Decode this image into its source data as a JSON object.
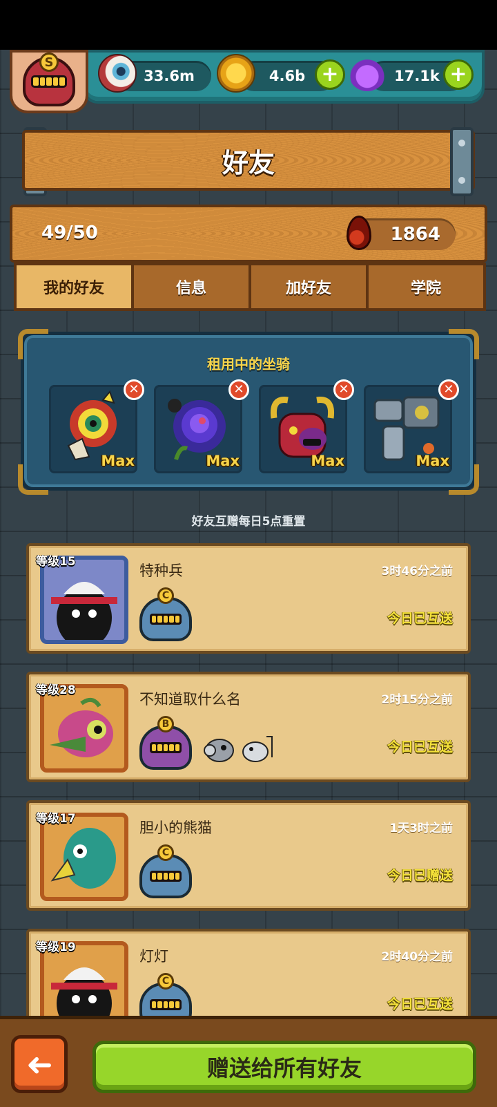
{
  "resources": {
    "eyes": "33.6m",
    "coins": "4.6b",
    "potions": "17.1k",
    "plus": "+"
  },
  "profile": {
    "rank": "S"
  },
  "title": "好友",
  "friend_count": "49/50",
  "blood": "1864",
  "tabs": [
    {
      "label": "我的好友",
      "active": true
    },
    {
      "label": "信息",
      "active": false
    },
    {
      "label": "加好友",
      "active": false
    },
    {
      "label": "学院",
      "active": false
    }
  ],
  "rental": {
    "title": "租用中的坐骑",
    "mounts": [
      {
        "icon": "dragon-mount-icon",
        "level": "Max",
        "remove": "✕"
      },
      {
        "icon": "rose-mount-icon",
        "level": "Max",
        "remove": "✕"
      },
      {
        "icon": "demon-mount-icon",
        "level": "Max",
        "remove": "✕"
      },
      {
        "icon": "machine-mount-icon",
        "level": "Max",
        "remove": "✕"
      }
    ]
  },
  "reset_note": "好友互赠每日5点重置",
  "friends": [
    {
      "level": "等级15",
      "name": "特种兵",
      "time": "3时46分之前",
      "status": "今日已互送",
      "rank": "C"
    },
    {
      "level": "等级28",
      "name": "不知道取什么名",
      "time": "2时15分之前",
      "status": "今日已互送",
      "rank": "B"
    },
    {
      "level": "等级17",
      "name": "胆小的熊猫",
      "time": "1天3时之前",
      "status": "今日已赠送",
      "rank": "C"
    },
    {
      "level": "等级19",
      "name": "灯灯",
      "time": "2时40分之前",
      "status": "今日已互送",
      "rank": "C"
    }
  ],
  "bottom": {
    "back_icon": "➜",
    "gift_all_label": "赠送给所有好友"
  },
  "colors": {
    "accent_green": "#97d62a",
    "wood": "#d9923f",
    "panel_blue": "#285772",
    "status_yellow": "#f5e23a"
  }
}
